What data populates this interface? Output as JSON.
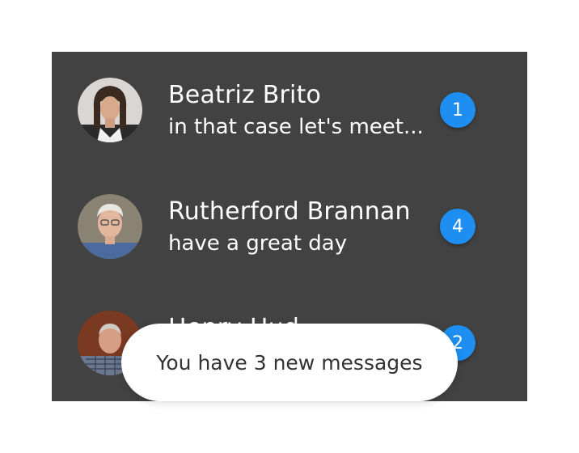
{
  "conversations": [
    {
      "name": "Beatriz Brito",
      "preview": "in that case let's meet...",
      "unread": "1",
      "avatar": "woman-portrait"
    },
    {
      "name": "Rutherford Brannan",
      "preview": "have a great day",
      "unread": "4",
      "avatar": "older-man-glasses-portrait"
    },
    {
      "name": "Henry Hud",
      "preview": "",
      "unread": "2",
      "avatar": "older-man-plaid-shirt-portrait"
    }
  ],
  "toast": {
    "message": "You have 3 new messages"
  },
  "colors": {
    "panel_background": "#424242",
    "badge": "#1e8ff0",
    "toast_background": "#ffffff",
    "toast_text": "#333333"
  }
}
